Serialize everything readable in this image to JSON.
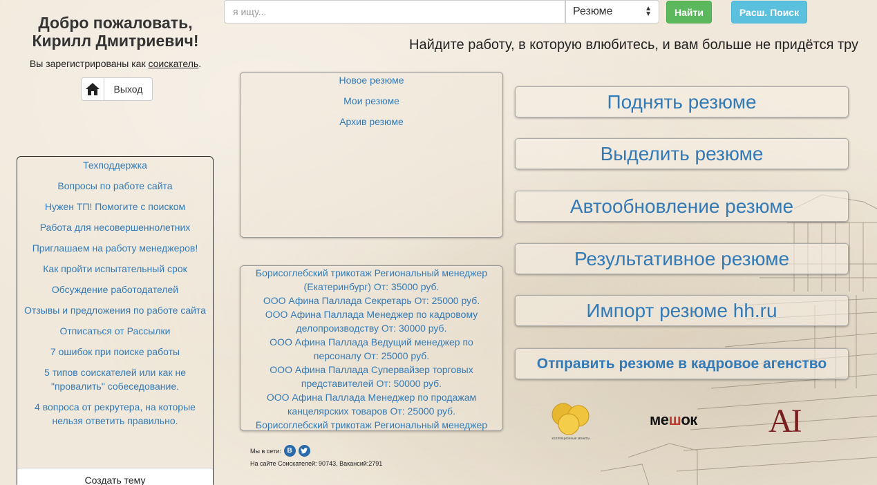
{
  "search": {
    "placeholder": "я ищу...",
    "category": "Резюме",
    "find_label": "Найти",
    "advanced_label": "Расш. Поиск"
  },
  "tagline": "Найдите работу, в которую влюбитесь, и вам больше не придётся тру",
  "welcome": {
    "title_line1": "Добро пожаловать,",
    "title_line2": "Кирилл Дмитриевич!",
    "registered_prefix": "Вы зарегистрированы как ",
    "registered_role": "соискатель",
    "registered_suffix": ".",
    "logout_label": "Выход"
  },
  "forum": {
    "items": [
      "Техподдержка",
      "Вопросы по работе сайта",
      "Нужен ТП! Помогите с поиском",
      "Работа для несовершеннолетних",
      "Приглашаем на работу менеджеров!",
      "Как пройти испытательный срок",
      "Обсуждение работодателей",
      "Отзывы и предложения по работе сайта",
      "Отписаться от Рассылки",
      "7 ошибок при поиске работы",
      "5 типов соискателей или как не \"провалить\" собеседование.",
      "4 вопроса от рекрутера, на которые нельзя ответить правильно."
    ],
    "create_label": "Создать тему"
  },
  "resume_menu": [
    "Новое резюме",
    "Мои резюме",
    "Архив резюме"
  ],
  "vacancies": [
    "Борисоглебский трикотаж Региональный менеджер (Екатеринбург) От: 35000 руб.",
    "ООО Афина Паллада Секретарь От: 25000 руб.",
    "ООО Афина Паллада Менеджер по кадровому делопроизводству От: 30000 руб.",
    "ООО Афина Паллада Ведущий менеджер по персоналу От: 25000 руб.",
    "ООО Афина Паллада Супервайзер торговых представителей От: 50000 руб.",
    "ООО Афина Паллада Менеджер по продажам канцелярских товаров От: 25000 руб.",
    "Борисоглебский трикотаж Региональный менеджер"
  ],
  "footer": {
    "social_label": "Мы в сети:",
    "vk_letter": "B",
    "stats": "На сайте Соискателей: 90743, Вакансий:2791"
  },
  "actions": {
    "raise": "Поднять резюме",
    "highlight": "Выделить резюме",
    "autoupdate": "Автообновление резюме",
    "effective": "Результативное резюме",
    "import_hh": "Импорт резюме hh.ru",
    "send_agency": "Отправить резюме в кадровое агенство"
  },
  "partners": {
    "coins_text": "коллекционные монеты",
    "meshok_pre": "ме",
    "meshok_sh": "ш",
    "meshok_post": "ок",
    "ai": "AI"
  },
  "colors": {
    "link": "#337ab7",
    "success": "#5cb85c",
    "info": "#5bc0de",
    "background": "#f0e8da"
  }
}
